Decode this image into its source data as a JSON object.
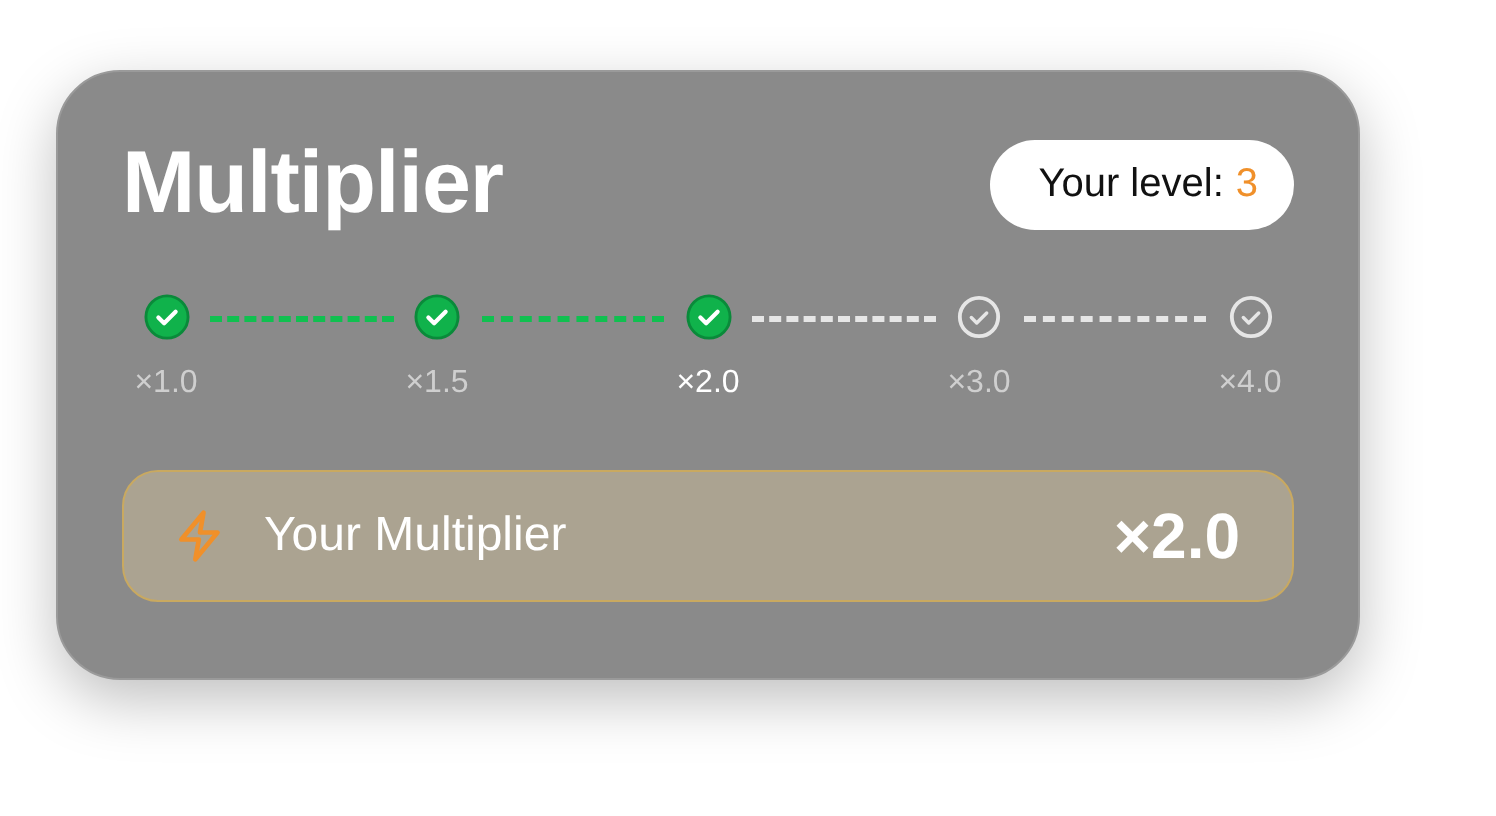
{
  "title": "Multiplier",
  "level_badge": {
    "label": "Your level:",
    "value": "3"
  },
  "steps": [
    {
      "label": "×1.0",
      "reached": true,
      "selected": false
    },
    {
      "label": "×1.5",
      "reached": true,
      "selected": false
    },
    {
      "label": "×2.0",
      "reached": true,
      "selected": true
    },
    {
      "label": "×3.0",
      "reached": false,
      "selected": false
    },
    {
      "label": "×4.0",
      "reached": false,
      "selected": false
    }
  ],
  "multiplier": {
    "label": "Your Multiplier",
    "value": "×2.0"
  }
}
